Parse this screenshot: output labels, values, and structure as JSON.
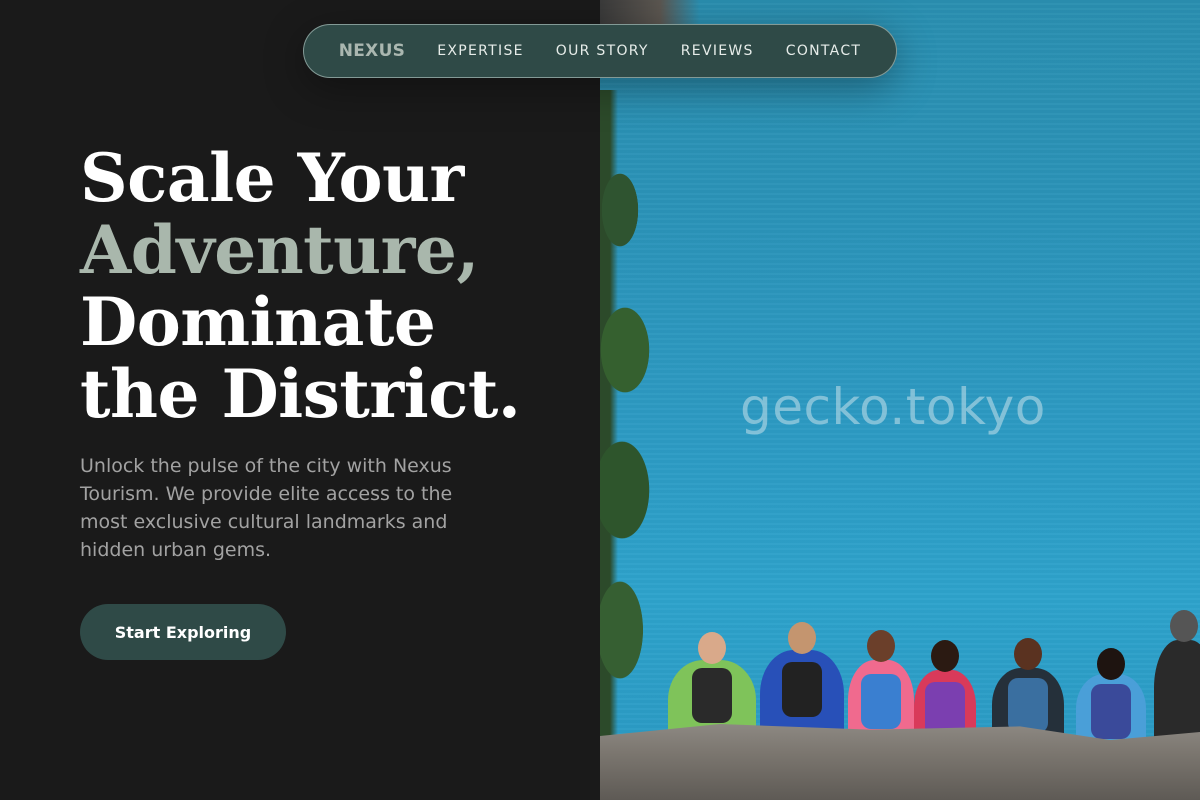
{
  "nav": {
    "brand": "NEXUS",
    "links": [
      "EXPERTISE",
      "OUR STORY",
      "REVIEWS",
      "CONTACT"
    ]
  },
  "hero": {
    "title_line1": "Scale Your",
    "title_line2": "Adventure,",
    "title_line3": "Dominate",
    "title_line4": "the District.",
    "subtitle": "Unlock the pulse of the city with Nexus Tourism. We provide elite access to the most exclusive cultural landmarks and hidden urban gems.",
    "cta_label": "Start Exploring"
  },
  "image": {
    "watermark": "gecko.tokyo",
    "subject": "hikers-at-lake-photo"
  },
  "colors": {
    "background": "#1a1a1a",
    "accent": "#2f4a47",
    "title_accent": "#a9b7ac",
    "subtitle": "#a2a2a2"
  }
}
